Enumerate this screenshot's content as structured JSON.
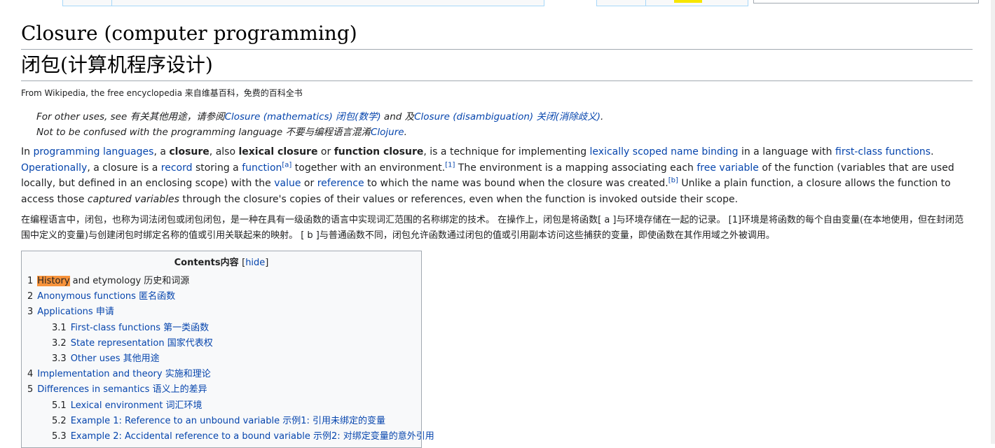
{
  "title_en": "Closure (computer programming)",
  "title_zh": "闭包(计算机程序设计)",
  "subtitle": "From Wikipedia, the free encyclopedia 来自维基百科，免费的百科全书",
  "hatnote": {
    "line1": {
      "prefix": "For other uses, see 有关其他用途，请参阅",
      "link1": "Closure (mathematics) 闭包(数学)",
      "middle": " and 及",
      "link2": "Closure (disambiguation) 关闭(消除歧义)",
      "suffix": "."
    },
    "line2": {
      "prefix": "Not to be confused with the programming language 不要与编程语言混淆",
      "link": "Clojure",
      "suffix": "."
    }
  },
  "paragraph": {
    "t1": "In ",
    "l_programming_languages": "programming languages",
    "t2": ", a ",
    "b_closure": "closure",
    "t3": ", also ",
    "b_lexical": "lexical closure",
    "t4": " or ",
    "b_function": "function closure",
    "t5": ", is a technique for implementing ",
    "l_lexical_scoped": "lexically scoped",
    "t6": " ",
    "l_name_binding": "name binding",
    "t7": " in a language with ",
    "l_first_class": "first-class functions",
    "t8": ". ",
    "l_operationally": "Operationally",
    "t9": ", a closure is a ",
    "l_record": "record",
    "t10": " storing a ",
    "l_function": "function",
    "sup_a": "[a]",
    "t11": " together with an environment.",
    "sup_1": "[1]",
    "t12": " The environment is a mapping associating each ",
    "l_free_variable": "free variable",
    "t13": " of the function (variables that are used locally, but defined in an enclosing scope) with the ",
    "l_value": "value",
    "t14": " or ",
    "l_reference": "reference",
    "t15": " to which the name was bound when the closure was created.",
    "sup_b": "[b]",
    "t16": " Unlike a plain function, a closure allows the function to access those ",
    "i_captured": "captured variables",
    "t17": " through the closure's copies of their values or references, even when the function is invoked outside their scope."
  },
  "paragraph_zh": "在编程语言中，闭包，也称为词法闭包或闭包闭包，是一种在具有一级函数的语言中实现词汇范围的名称绑定的技术。 在操作上，闭包是将函数[ a ]与环境存储在一起的记录。 [1]环境是将函数的每个自由变量(在本地使用，但在封闭范围中定义的变量)与创建闭包时绑定名称的值或引用关联起来的映射。 [ b ]与普通函数不同，闭包允许函数通过闭包的值或引用副本访问这些捕获的变量，即使函数在其作用域之外被调用。",
  "toc": {
    "title": "Contents内容",
    "hide_open": "[",
    "hide_label": "hide",
    "hide_close": "]",
    "items": [
      {
        "num": "1",
        "hl": "History",
        "rest": " and etymology 历史和词源"
      },
      {
        "num": "2",
        "label": "Anonymous functions 匿名函数"
      },
      {
        "num": "3",
        "label": "Applications 申请"
      },
      {
        "num": "3.1",
        "label": "First-class functions 第一类函数"
      },
      {
        "num": "3.2",
        "label": "State representation 国家代表权"
      },
      {
        "num": "3.3",
        "label": "Other uses 其他用途"
      },
      {
        "num": "4",
        "label": "Implementation and theory 实施和理论"
      },
      {
        "num": "5",
        "label": "Differences in semantics 语义上的差异"
      },
      {
        "num": "5.1",
        "label": "Lexical environment 词汇环境"
      },
      {
        "num": "5.2",
        "label": "Example 1: Reference to an unbound variable 示例1: 引用未绑定的变量"
      },
      {
        "num": "5.3",
        "label": "Example 2: Accidental reference to a bound variable 示例2: 对绑定变量的意外引用"
      }
    ]
  },
  "colors": {
    "link": "#0645ad",
    "highlight": "#f7933b",
    "toc_bg": "#f8f9fa",
    "border": "#a2a9b1"
  }
}
